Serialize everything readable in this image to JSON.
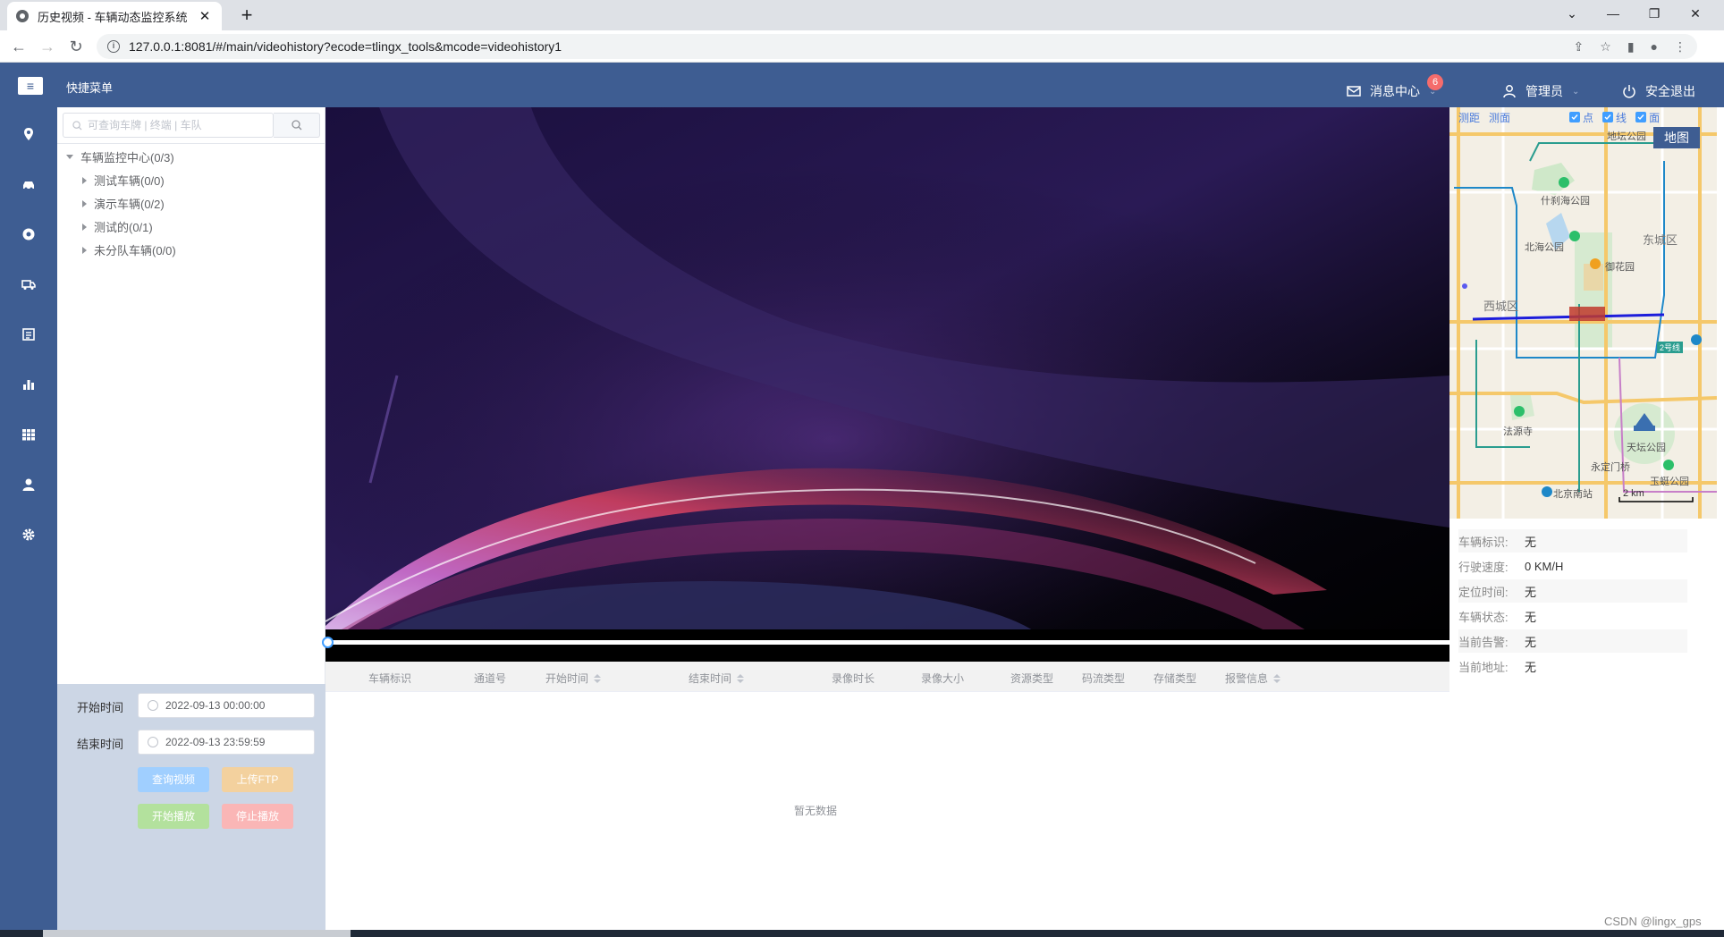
{
  "browser": {
    "tab_title": "历史视频 - 车辆动态监控系统",
    "tab_close": "✕",
    "new_tab": "+",
    "url": "127.0.0.1:8081/#/main/videohistory?ecode=tlingx_tools&mcode=videohistory1",
    "window_controls": [
      "⌄",
      "—",
      "❐",
      "✕"
    ]
  },
  "header": {
    "menu_icon": "≡",
    "quick_menu": "快捷菜单",
    "message_center": "消息中心",
    "message_count": "6",
    "admin": "管理员",
    "logout": "安全退出"
  },
  "sidebar_icons": [
    "location-icon",
    "car-icon",
    "target-icon",
    "truck-icon",
    "report-icon",
    "chart-icon",
    "grid-icon",
    "user-icon",
    "settings-icon"
  ],
  "tree": {
    "search_placeholder": "可查询车牌 | 终端 | 车队",
    "root": "车辆监控中心(0/3)",
    "children": [
      "测试车辆(0/0)",
      "演示车辆(0/2)",
      "测试的(0/1)",
      "未分队车辆(0/0)"
    ]
  },
  "query": {
    "start_label": "开始时间",
    "start_value": "2022-09-13 00:00:00",
    "end_label": "结束时间",
    "end_value": "2022-09-13 23:59:59",
    "query_btn": "查询视频",
    "upload_btn": "上传FTP",
    "play_btn": "开始播放",
    "stop_btn": "停止播放",
    "colors": {
      "query": "#a0cfff",
      "upload": "#f3d19e",
      "play": "#b3e19d",
      "stop": "#fab6b6"
    }
  },
  "table": {
    "columns": [
      "车辆标识",
      "通道号",
      "开始时间",
      "结束时间",
      "录像时长",
      "录像大小",
      "资源类型",
      "码流类型",
      "存储类型",
      "报警信息"
    ],
    "empty_text": "暂无数据"
  },
  "map": {
    "toggles": [
      "测距",
      "测面",
      "点",
      "线",
      "面"
    ],
    "map_button": "地图",
    "labels": [
      "地坛公园",
      "什刹海公园",
      "北海公园",
      "东城区",
      "御花园",
      "西城区",
      "2号线",
      "法源寺",
      "天坛公园",
      "永定门桥",
      "玉蜓公园",
      "北京南站"
    ],
    "scale": "2 km"
  },
  "vehicle_info": [
    {
      "label": "车辆标识:",
      "value": "无"
    },
    {
      "label": "行驶速度:",
      "value": "0 KM/H"
    },
    {
      "label": "定位时间:",
      "value": "无"
    },
    {
      "label": "车辆状态:",
      "value": "无"
    },
    {
      "label": "当前告警:",
      "value": "无"
    },
    {
      "label": "当前地址:",
      "value": "无"
    }
  ],
  "watermark": "CSDN @lingx_gps"
}
